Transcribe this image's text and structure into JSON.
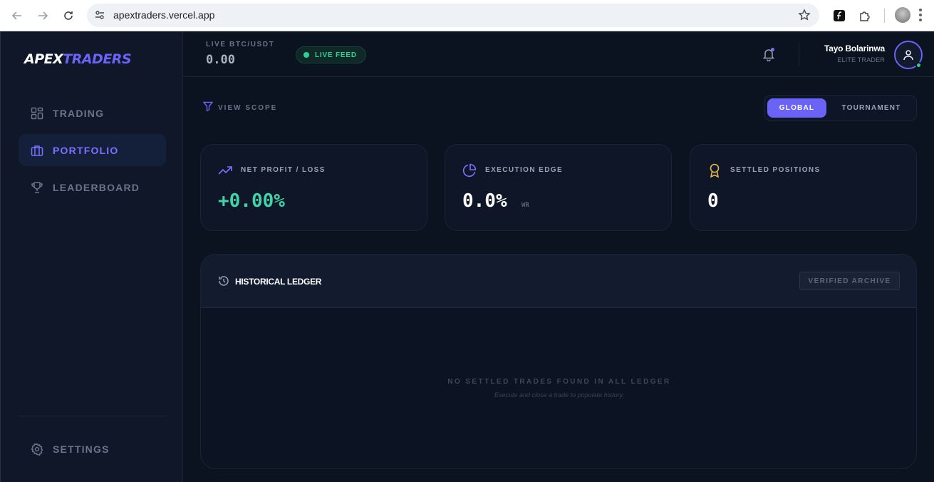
{
  "browser": {
    "url": "apextraders.vercel.app"
  },
  "brand": {
    "part1": "APEX",
    "part2": "TRADERS",
    "accent": "#6b63f5"
  },
  "sidebar": {
    "items": [
      {
        "label": "TRADING",
        "icon": "layout-grid-icon"
      },
      {
        "label": "PORTFOLIO",
        "icon": "briefcase-icon",
        "active": true
      },
      {
        "label": "LEADERBOARD",
        "icon": "trophy-icon"
      }
    ],
    "settings_label": "SETTINGS"
  },
  "header": {
    "ticker_label": "LIVE BTC/USDT",
    "ticker_value": "0.00",
    "live_label": "LIVE FEED",
    "user_name": "Tayo Bolarinwa",
    "user_role": "ELITE TRADER"
  },
  "main": {
    "scope_label": "VIEW SCOPE",
    "tabs": [
      {
        "label": "GLOBAL",
        "selected": true
      },
      {
        "label": "TOURNAMENT",
        "selected": false
      }
    ],
    "stats": [
      {
        "label": "NET PROFIT / LOSS",
        "value": "+0.00%",
        "sub": "",
        "icon": "trending-up-icon",
        "value_color": "#3fd5a8"
      },
      {
        "label": "EXECUTION EDGE",
        "value": "0.0%",
        "sub": "WR",
        "icon": "pie-chart-icon",
        "value_color": "#ffffff"
      },
      {
        "label": "SETTLED POSITIONS",
        "value": "0",
        "sub": "",
        "icon": "award-icon",
        "value_color": "#ffffff"
      }
    ],
    "ledger": {
      "title": "HISTORICAL LEDGER",
      "badge": "VERIFIED ARCHIVE",
      "empty_title": "NO SETTLED TRADES FOUND IN ALL LEDGER",
      "empty_sub": "Execute and close a trade to populate history."
    }
  }
}
